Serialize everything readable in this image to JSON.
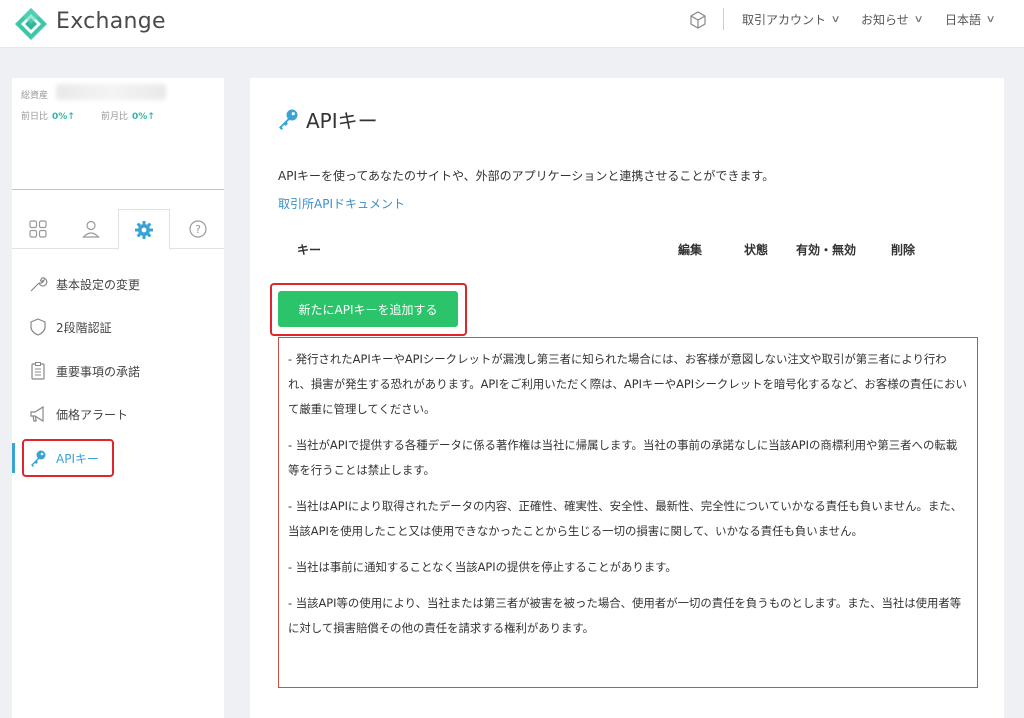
{
  "header": {
    "brand": "Exchange",
    "menu": [
      {
        "label": "取引アカウント"
      },
      {
        "label": "お知らせ"
      },
      {
        "label": "日本語"
      }
    ]
  },
  "sidebar": {
    "balance_label": "総資産",
    "day_change_label": "前日比",
    "day_change_value": "0%↑",
    "month_change_label": "前月比",
    "month_change_value": "0%↑",
    "tabs": [
      {
        "icon": "grid-icon"
      },
      {
        "icon": "user-icon"
      },
      {
        "icon": "gear-icon"
      },
      {
        "icon": "help-icon"
      }
    ],
    "items": [
      {
        "label": "基本設定の変更",
        "icon": "wrench-icon"
      },
      {
        "label": "2段階認証",
        "icon": "shield-icon"
      },
      {
        "label": "重要事項の承諾",
        "icon": "clipboard-icon"
      },
      {
        "label": "価格アラート",
        "icon": "megaphone-icon"
      },
      {
        "label": "APIキー",
        "icon": "key-icon"
      }
    ],
    "accent_color": "#3aa3d5"
  },
  "main": {
    "title": "APIキー",
    "description": "APIキーを使ってあなたのサイトや、外部のアプリケーションと連携させることができます。",
    "doc_link": "取引所APIドキュメント",
    "table_headers": {
      "key": "キー",
      "edit": "編集",
      "status": "状態",
      "enable": "有効・無効",
      "delete": "削除"
    },
    "add_button": "新たにAPIキーを追加する",
    "button_color": "#2bc46a",
    "notices": [
      "- 発行されたAPIキーやAPIシークレットが漏洩し第三者に知られた場合には、お客様が意図しない注文や取引が第三者により行われ、損害が発生する恐れがあります。APIをご利用いただく際は、APIキーやAPIシークレットを暗号化するなど、お客様の責任において厳重に管理してください。",
      "- 当社がAPIで提供する各種データに係る著作権は当社に帰属します。当社の事前の承諾なしに当該APIの商標利用や第三者への転載等を行うことは禁止します。",
      "- 当社はAPIにより取得されたデータの内容、正確性、確実性、安全性、最新性、完全性についていかなる責任も負いません。また、当該APIを使用したこと又は使用できなかったことから生じる一切の損害に関して、いかなる責任も負いません。",
      "- 当社は事前に通知することなく当該APIの提供を停止することがあります。",
      "- 当該API等の使用により、当社または第三者が被害を被った場合、使用者が一切の責任を負うものとします。また、当社は使用者等に対して損害賠償その他の責任を請求する権利があります。"
    ]
  }
}
